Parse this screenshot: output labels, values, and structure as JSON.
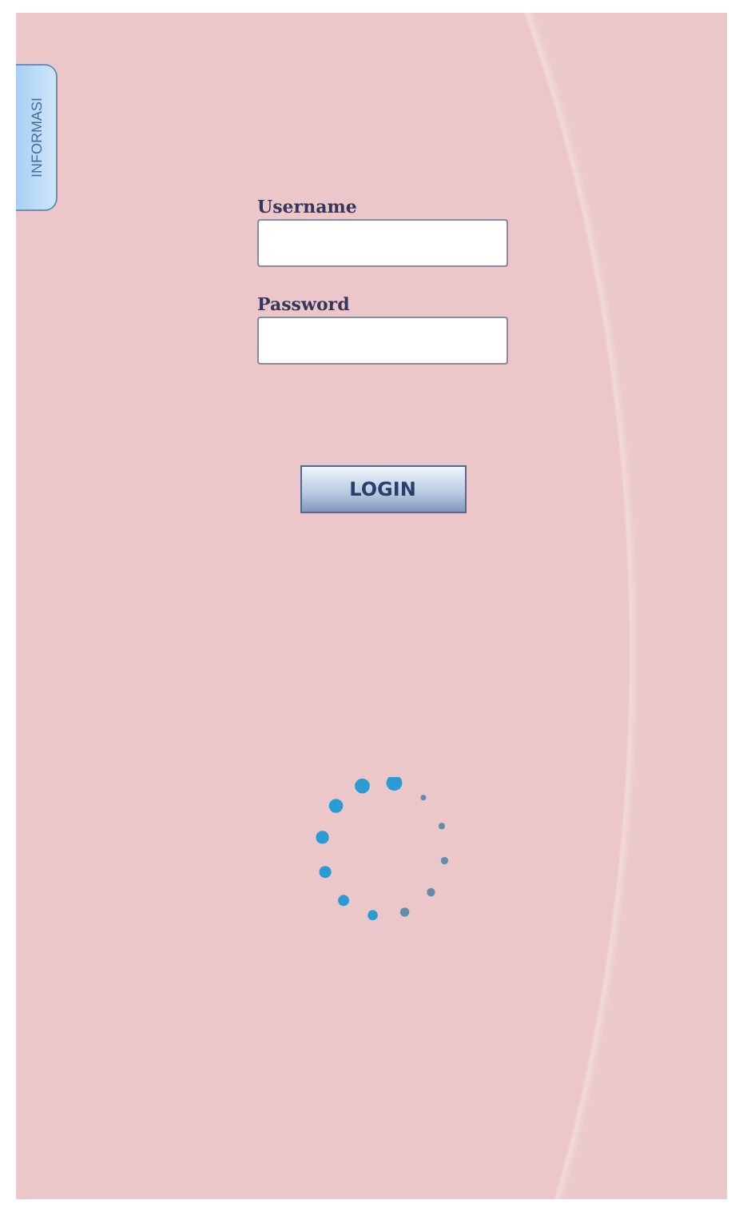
{
  "side_tab": {
    "label": "INFORMASI"
  },
  "form": {
    "fields": [
      {
        "label": "Username"
      },
      {
        "label": "Password"
      }
    ],
    "button": "LOGIN"
  },
  "spinner": {
    "visible": true
  }
}
